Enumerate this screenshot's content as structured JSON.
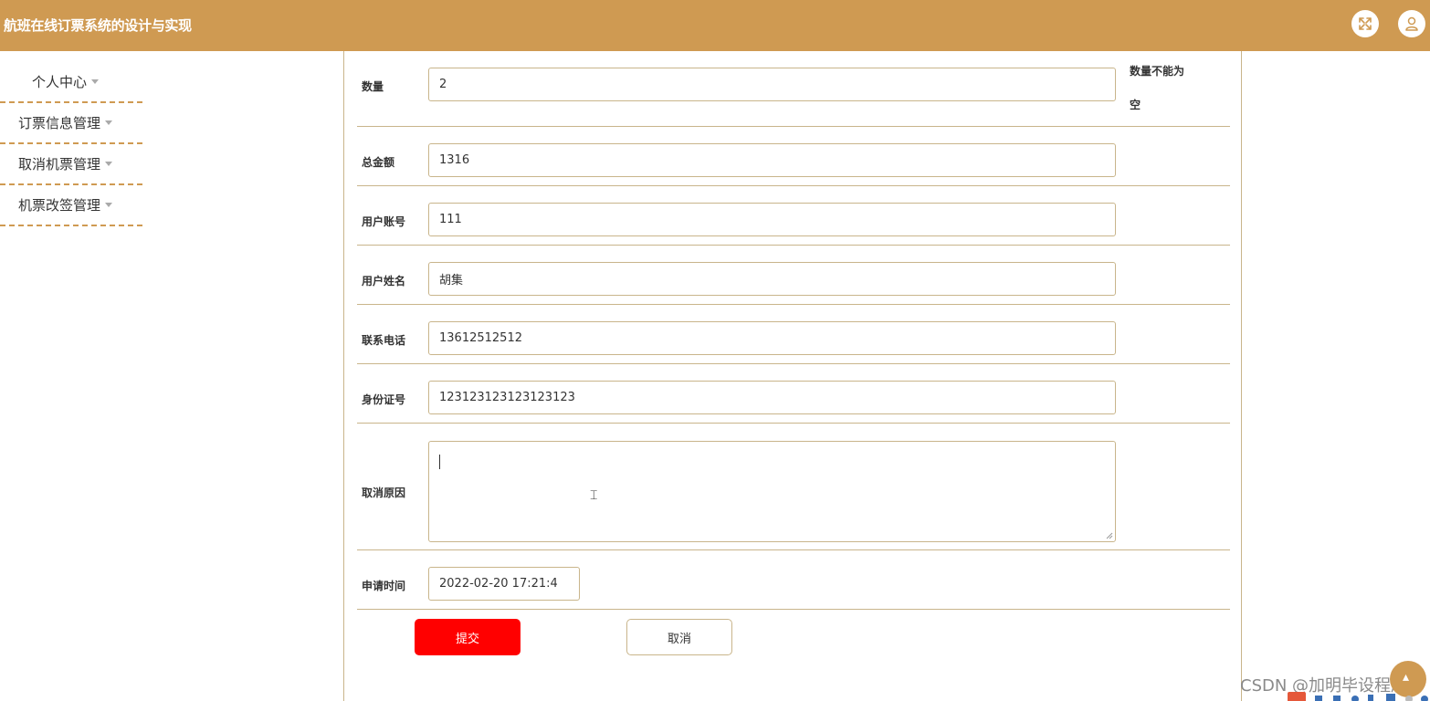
{
  "header": {
    "title": "航班在线订票系统的设计与实现",
    "fullscreen_icon": "fullscreen-icon",
    "user_icon": "user-icon"
  },
  "sidebar": {
    "items": [
      {
        "label": "个人中心"
      },
      {
        "label": "订票信息管理"
      },
      {
        "label": "取消机票管理"
      },
      {
        "label": "机票改签管理"
      }
    ]
  },
  "form": {
    "quantity": {
      "label": "数量",
      "value": "2",
      "error": "数量不能为空"
    },
    "total": {
      "label": "总金额",
      "value": "1316"
    },
    "account": {
      "label": "用户账号",
      "value": "111"
    },
    "name": {
      "label": "用户姓名",
      "value": "胡集"
    },
    "phone": {
      "label": "联系电话",
      "value": "13612512512"
    },
    "id_number": {
      "label": "身份证号",
      "value": "123123123123123123"
    },
    "reason": {
      "label": "取消原因",
      "value": ""
    },
    "apply_time": {
      "label": "申请时间",
      "value": "2022-02-20 17:21:4"
    },
    "submit_label": "提交",
    "cancel_label": "取消"
  },
  "watermark": "CSDN @加明毕设程序",
  "colors": {
    "header_bg": "#cf9a52",
    "border": "#c9b58b",
    "submit_bg": "#ff0000"
  }
}
